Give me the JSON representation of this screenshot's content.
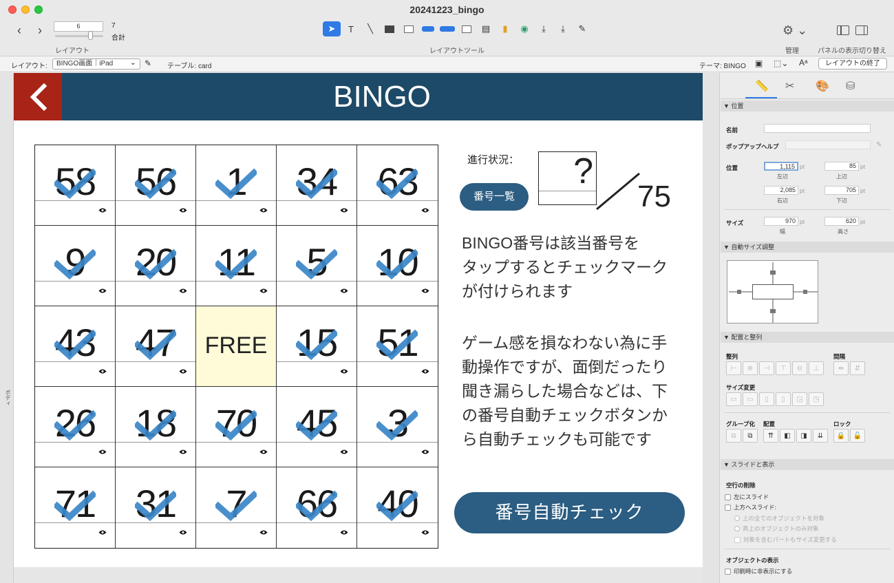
{
  "window": {
    "title": "20241223_bingo"
  },
  "toolbar": {
    "layout_number": "6",
    "layout_total": "7",
    "total_label": "合計",
    "layout_caption": "レイアウト",
    "tools_caption": "レイアウトツール",
    "manage_caption": "管理",
    "panel_caption": "パネルの表示切り替え"
  },
  "layout_bar": {
    "layout_label": "レイアウト:",
    "layout_value": "BINGO画面｜iPad",
    "table_label": "テーブル: card",
    "theme_label": "テーマ: BINGO",
    "end_button": "レイアウトの終了",
    "body_part": "ボディ"
  },
  "app": {
    "title": "BINGO",
    "progress_label": "進行状況：",
    "progress_value": "?",
    "total": "75",
    "list_button": "番号一覧",
    "description_1": "BINGO番号は該当番号を\nタップするとチェックマーク\nが付けられます",
    "description_2": "ゲーム感を損なわない為に手\n動操作ですが、面倒だったり\n聞き漏らした場合などは、下\nの番号自動チェックボタンか\nら自動チェックも可能です",
    "auto_check_button": "番号自動チェック",
    "free_label": "FREE",
    "numbers": [
      "58",
      "56",
      "1",
      "34",
      "63",
      "9",
      "20",
      "11",
      "5",
      "10",
      "43",
      "47",
      "FREE",
      "15",
      "51",
      "26",
      "18",
      "70",
      "45",
      "3",
      "71",
      "31",
      "7",
      "66",
      "40"
    ]
  },
  "inspector": {
    "section_position": "▼ 位置",
    "name_label": "名前",
    "popup_help_label": "ポップアップヘルプ",
    "position_label": "位置",
    "left_value": "1,115",
    "top_value": "85",
    "right_value": "2,085",
    "bottom_value": "705",
    "left_caption": "左辺",
    "top_caption": "上辺",
    "right_caption": "右辺",
    "bottom_caption": "下辺",
    "unit": "pt",
    "size_label": "サイズ",
    "width_value": "970",
    "height_value": "620",
    "width_caption": "幅",
    "height_caption": "高さ",
    "section_autosize": "▼ 自動サイズ調整",
    "section_arrange": "▼ 配置と整列",
    "align_label": "整列",
    "spacing_label": "間隔",
    "resize_label": "サイズ変更",
    "group_label": "グループ化",
    "arrange_label": "配置",
    "lock_label": "ロック",
    "section_slide": "▼ スライドと表示",
    "remove_blank_label": "空行の削除",
    "slide_left": "左にスライド",
    "slide_up": "上方へスライド:",
    "opt_all_above": "上の全てのオブジェクトを対象",
    "opt_directly_above": "真上のオブジェクトのみ対象",
    "opt_resize_part": "対象を含むパートもサイズ変更する",
    "object_display_label": "オブジェクトの表示",
    "hide_when_printing": "印刷時に非表示にする"
  },
  "colors": {
    "header_bg": "#1d4a68",
    "back_bg": "#a82417",
    "check": "#3a86c8",
    "button_bg": "#2c5d82",
    "free_bg": "#fffbd8"
  }
}
